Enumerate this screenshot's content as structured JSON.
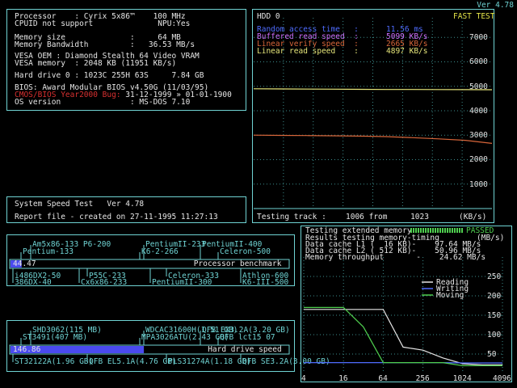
{
  "version": "Ver 4.78",
  "sysinfo": {
    "processor": "Processor    : Cyrix 5x86™    100 MHz",
    "cpuid": "CPUID not support              NPU:Yes",
    "mem_size": "Memory size              :     64 MB",
    "mem_bw": "Memory Bandwidth         :   36.53 MB/s",
    "vesa_oem": "VESA OEM : Diamond Stealth 64 Video VRAM",
    "vesa_mem": "VESA memory  : 2048 KB (11951 KB/s)",
    "hdd": "Hard drive 0 : 1023C 255H 63S     7.84 GB",
    "bios": "BIOS: Award Modular BIOS v4.50G (11/03/95)",
    "y2k_label": "CMOS/BIOS Year2000 Bug:",
    "y2k_value": " 31-12-1999 » 01-01-1900",
    "os": "OS version               : MS-DOS 7.10"
  },
  "report": {
    "line1": "System Speed Test   Ver 4.78",
    "line2": "Report file - created on 27-11-1995 11:27:13"
  },
  "hdd_panel": {
    "title": "HDD 0",
    "mode": "FAST TEST",
    "stats": [
      {
        "label": "Random access time   :",
        "value": "11.56 ms",
        "color": "#4f6cff"
      },
      {
        "label": "Buffered read speed  :",
        "value": "5099 KB/s",
        "color": "#d070ff"
      },
      {
        "label": "Linear verify speed  :",
        "value": "2665 KB/s",
        "color": "#d8663a"
      },
      {
        "label": "Linear read speed    :",
        "value": "4897 KB/s",
        "color": "#e6e67a"
      }
    ],
    "y_ticks": [
      "7000",
      "6000",
      "5000",
      "4000",
      "3000",
      "2000",
      "1000"
    ],
    "track_label": "Testing track :",
    "track_value": "1006 from     1023",
    "unit": "(KB/s)"
  },
  "hdd_chart_data": {
    "type": "line",
    "ylim": [
      0,
      7800
    ],
    "series": [
      {
        "color": "#e6e67a",
        "values": [
          4897,
          4890,
          4885,
          4880,
          4875,
          4870,
          4868,
          4865,
          4862,
          4860
        ]
      },
      {
        "color": "#d8663a",
        "values": [
          3000,
          2990,
          2985,
          2975,
          2960,
          2940,
          2900,
          2850,
          2790,
          2665
        ]
      }
    ]
  },
  "cpu_bench": {
    "top_labels": [
      "Am5x86-133 P6-200",
      "PentiumII-233",
      "PentiumII-400",
      "Pentium-133",
      "K6-2-266",
      "Celeron-500"
    ],
    "bottom_labels": [
      "i486DX2-50",
      "P55C-233",
      "Celeron-333",
      "Athlon-600",
      "386DX-40",
      "Cx6x86-233",
      "PentiumII-300",
      "K6-III-500"
    ],
    "value": "44.47",
    "fraction": 0.04,
    "caption": "Processor benchmark",
    "bar_color": "#4a4aef"
  },
  "hdd_bench": {
    "top_labels": [
      "SHD3062(115 MB)",
      "WDCAC31600H(1.51 GB)",
      "QFB EX3.2A(3.20 GB)",
      "ST3491(407 MB)",
      "MPA3026ATU(2.43 GB)",
      "QFB lct15 07"
    ],
    "bottom_labels": [
      "ST32122A(1.96 GB)",
      "QFB EL5.1A(4.76 GB)",
      "PLS31274A(1.18 GB)",
      "QFB SE3.2A(3.00 GB)"
    ],
    "value": "146.86",
    "fraction": 0.48,
    "caption": "Hard drive speed",
    "bar_color": "#4a4aef"
  },
  "memory_test": {
    "line1": "Testing extended memory...",
    "status": "PASSED",
    "line2": "Results testing memory-timing",
    "unit": "(MB/s)",
    "l1": "Data cache L1 (  16 KB)-    97.64 MB/s",
    "l2": "Data cache L2 ( 512 KB)-    50.96 MB/s",
    "mem": "Memory throughput       -    24.62 MB/s",
    "y_ticks": [
      "250",
      "200",
      "150",
      "100",
      "50"
    ],
    "x_ticks": [
      "4",
      "16",
      "64",
      "256",
      "1024",
      "4096"
    ],
    "legend": [
      {
        "name": "Reading",
        "color": "#e6e6e6"
      },
      {
        "name": "Writing",
        "color": "#4f6cff"
      },
      {
        "name": "Moving",
        "color": "#4fcf4f"
      }
    ]
  },
  "mem_chart_data": {
    "type": "line",
    "x": [
      4,
      8,
      16,
      32,
      64,
      128,
      256,
      512,
      1024,
      2048,
      4096
    ],
    "ylim": [
      0,
      300
    ],
    "series": [
      {
        "name": "Reading",
        "color": "#e6e6e6",
        "values": [
          165,
          165,
          165,
          165,
          165,
          68,
          60,
          40,
          25,
          22,
          22
        ]
      },
      {
        "name": "Writing",
        "color": "#4f6cff",
        "values": [
          28,
          28,
          28,
          28,
          28,
          28,
          28,
          28,
          27,
          27,
          27
        ]
      },
      {
        "name": "Moving",
        "color": "#4fcf4f",
        "values": [
          170,
          170,
          170,
          120,
          28,
          28,
          28,
          28,
          20,
          20,
          20
        ]
      }
    ]
  }
}
